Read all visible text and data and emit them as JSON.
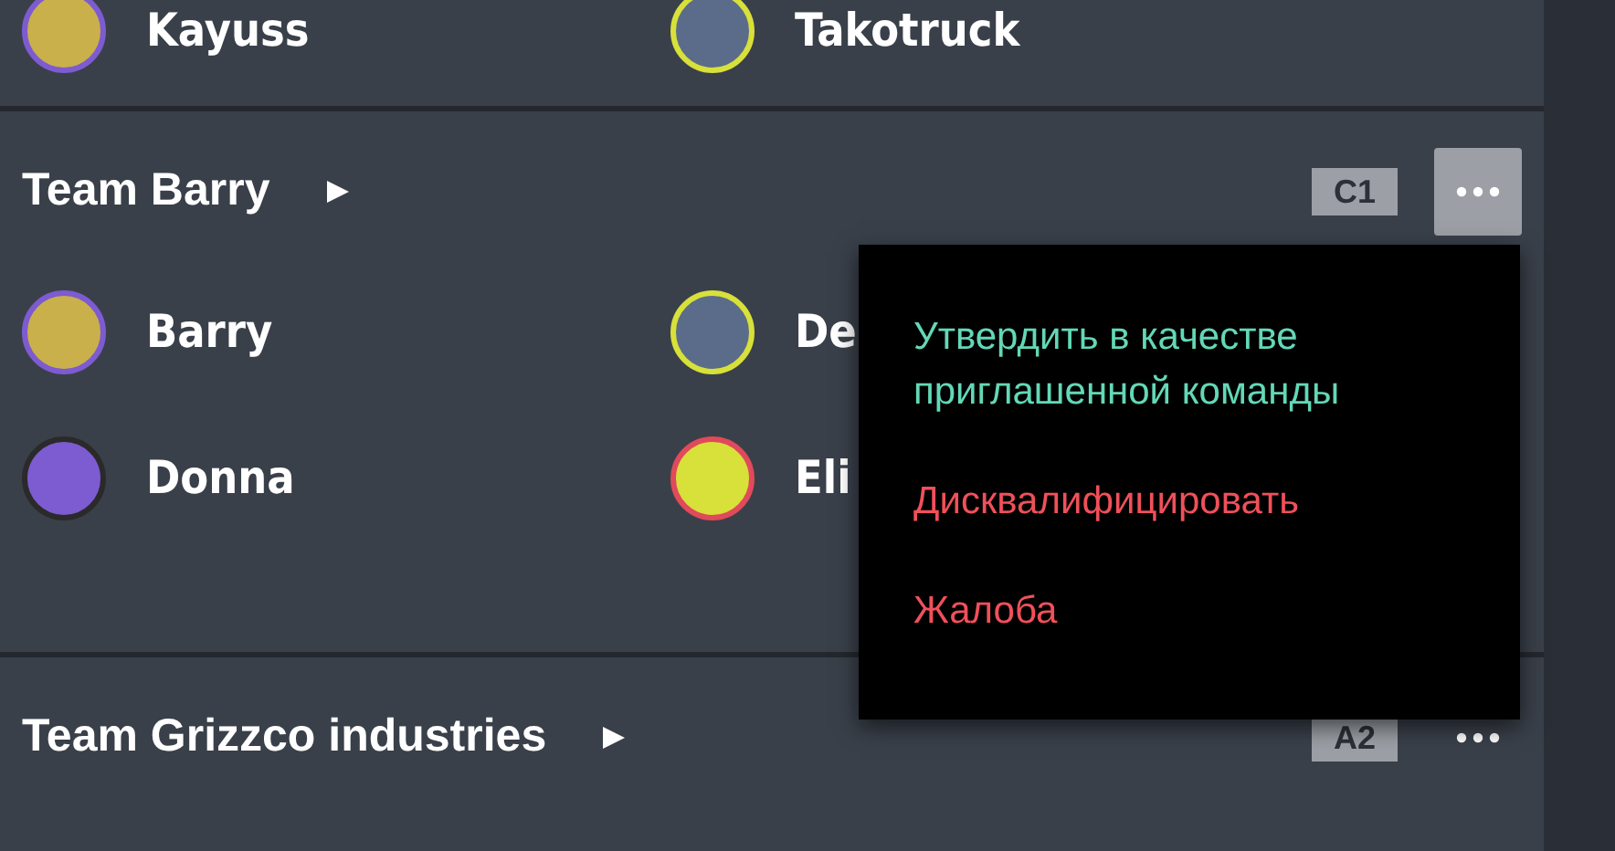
{
  "teams": [
    {
      "players": [
        {
          "name": "Kayuss"
        },
        {
          "name": "Takotruck"
        }
      ]
    },
    {
      "name": "Team Barry",
      "seed": "C1",
      "menu_open": true,
      "players": [
        {
          "name": "Barry"
        },
        {
          "name": "De"
        },
        {
          "name": "Donna"
        },
        {
          "name": "Eli"
        }
      ],
      "menu": [
        {
          "label": "Утвердить в качестве приглашенной команды",
          "kind": "approve"
        },
        {
          "label": "Дисквалифицировать",
          "kind": "danger"
        },
        {
          "label": "Жалоба",
          "kind": "danger"
        }
      ]
    },
    {
      "name": "Team Grizzco industries",
      "seed": "A2",
      "menu_open": false
    }
  ]
}
